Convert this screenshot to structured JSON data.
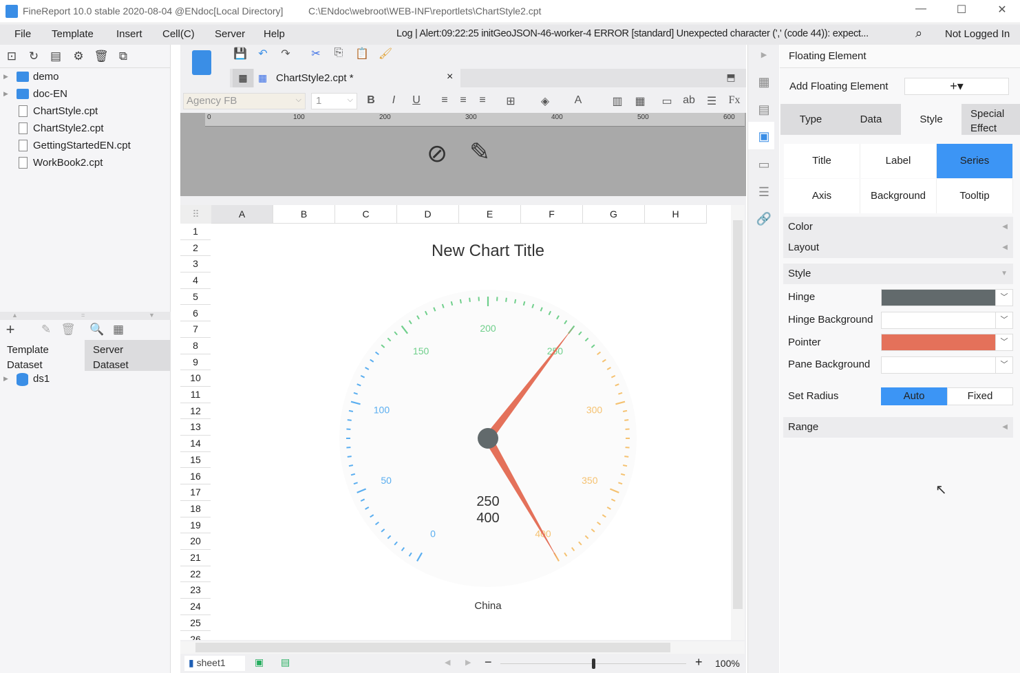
{
  "window": {
    "app_title": "FineReport 10.0 stable 2020-08-04 @ENdoc[Local Directory]",
    "file_path": "C:\\ENdoc\\webroot\\WEB-INF\\reportlets\\ChartStyle2.cpt",
    "minimize": "—",
    "maximize": "☐",
    "close": "✕"
  },
  "menu": {
    "items": [
      "File",
      "Template",
      "Insert",
      "Cell(C)",
      "Server",
      "Help"
    ],
    "log": "Log | Alert:09:22:25 initGeoJSON-46-worker-4 ERROR [standard] Unexpected character (',' (code 44)): expect...",
    "login": "Not Logged In"
  },
  "tree": {
    "items": [
      {
        "label": "demo",
        "type": "folder"
      },
      {
        "label": "doc-EN",
        "type": "folder"
      },
      {
        "label": "ChartStyle.cpt",
        "type": "file"
      },
      {
        "label": "ChartStyle2.cpt",
        "type": "file"
      },
      {
        "label": "GettingStartedEN.cpt",
        "type": "file"
      },
      {
        "label": "WorkBook2.cpt",
        "type": "file"
      }
    ]
  },
  "dataset": {
    "tabs": [
      "Template\nDataset",
      "Server\nDataset"
    ],
    "tab_template": "Template",
    "tab_template2": "Dataset",
    "tab_server": "Server",
    "tab_server2": "Dataset",
    "items": [
      "ds1"
    ]
  },
  "editor": {
    "tab_label": "ChartStyle2.cpt *",
    "tab_close": "×",
    "font": "Agency FB",
    "font_size": "1",
    "ruler": [
      "0",
      "100",
      "200",
      "300",
      "400",
      "500",
      "600"
    ],
    "columns": [
      "A",
      "B",
      "C",
      "D",
      "E",
      "F",
      "G",
      "H"
    ],
    "rows": [
      "1",
      "2",
      "3",
      "4",
      "5",
      "6",
      "7",
      "8",
      "9",
      "10",
      "11",
      "12",
      "13",
      "14",
      "15",
      "16",
      "17",
      "18",
      "19",
      "20",
      "21",
      "22",
      "23",
      "24",
      "25",
      "26"
    ]
  },
  "bottom": {
    "sheet": "sheet1",
    "zoom_minus": "−",
    "zoom_plus": "+",
    "zoom": "100%",
    "zoom_level": 0.5
  },
  "right": {
    "title": "Floating Element",
    "add_label": "Add Floating Element",
    "add_btn": "+▾",
    "tabs": [
      "Type",
      "Data",
      "Style",
      "Special\nEffect"
    ],
    "tab_type": "Type",
    "tab_data": "Data",
    "tab_style": "Style",
    "tab_special1": "Special",
    "tab_special2": "Effect",
    "active_tab": "Style",
    "subtabs": [
      "Title",
      "Label",
      "Series",
      "Axis",
      "Background",
      "Tooltip"
    ],
    "active_subtab": "Series",
    "color": "Color",
    "layout": "Layout",
    "style": "Style",
    "hinge": "Hinge",
    "hinge_bg": "Hinge Background",
    "pointer": "Pointer",
    "pane_bg": "Pane Background",
    "set_radius": "Set Radius",
    "auto": "Auto",
    "fixed": "Fixed",
    "range": "Range",
    "colors": {
      "hinge": "#626a6c",
      "pointer": "#e4715a",
      "accent": "#3c95f5"
    }
  },
  "chart_data": {
    "type": "gauge",
    "title": "New Chart Title",
    "category": "China",
    "min": 0,
    "max": 400,
    "tick_labels": [
      "0",
      "50",
      "100",
      "150",
      "200",
      "250",
      "300",
      "350",
      "400"
    ],
    "values": [
      250,
      400
    ],
    "value_labels": [
      "250",
      "400"
    ],
    "bands": [
      {
        "from": 0,
        "to": 133.3,
        "color": "#5aaef0"
      },
      {
        "from": 133.3,
        "to": 266.7,
        "color": "#6fcf8b"
      },
      {
        "from": 266.7,
        "to": 400,
        "color": "#f5c271"
      }
    ],
    "pointer_color": "#e4715a",
    "hinge_color": "#626a6c"
  }
}
